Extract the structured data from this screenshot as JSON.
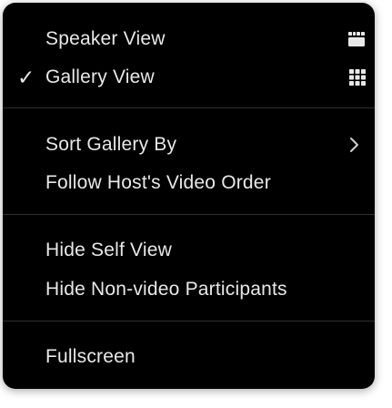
{
  "menu": {
    "items": [
      {
        "label": "Speaker View",
        "checked": false,
        "icon": "speaker-view-icon"
      },
      {
        "label": "Gallery View",
        "checked": true,
        "check_mark": "✓",
        "icon": "gallery-view-icon"
      },
      {
        "label": "Sort Gallery By",
        "submenu": true,
        "icon": "chevron-right-icon"
      },
      {
        "label": "Follow Host's Video Order"
      },
      {
        "label": "Hide Self View"
      },
      {
        "label": "Hide Non-video Participants"
      },
      {
        "label": "Fullscreen"
      }
    ]
  },
  "colors": {
    "menu_background": "#000000",
    "text": "#e8e8e8",
    "divider": "#2f2f2f"
  }
}
